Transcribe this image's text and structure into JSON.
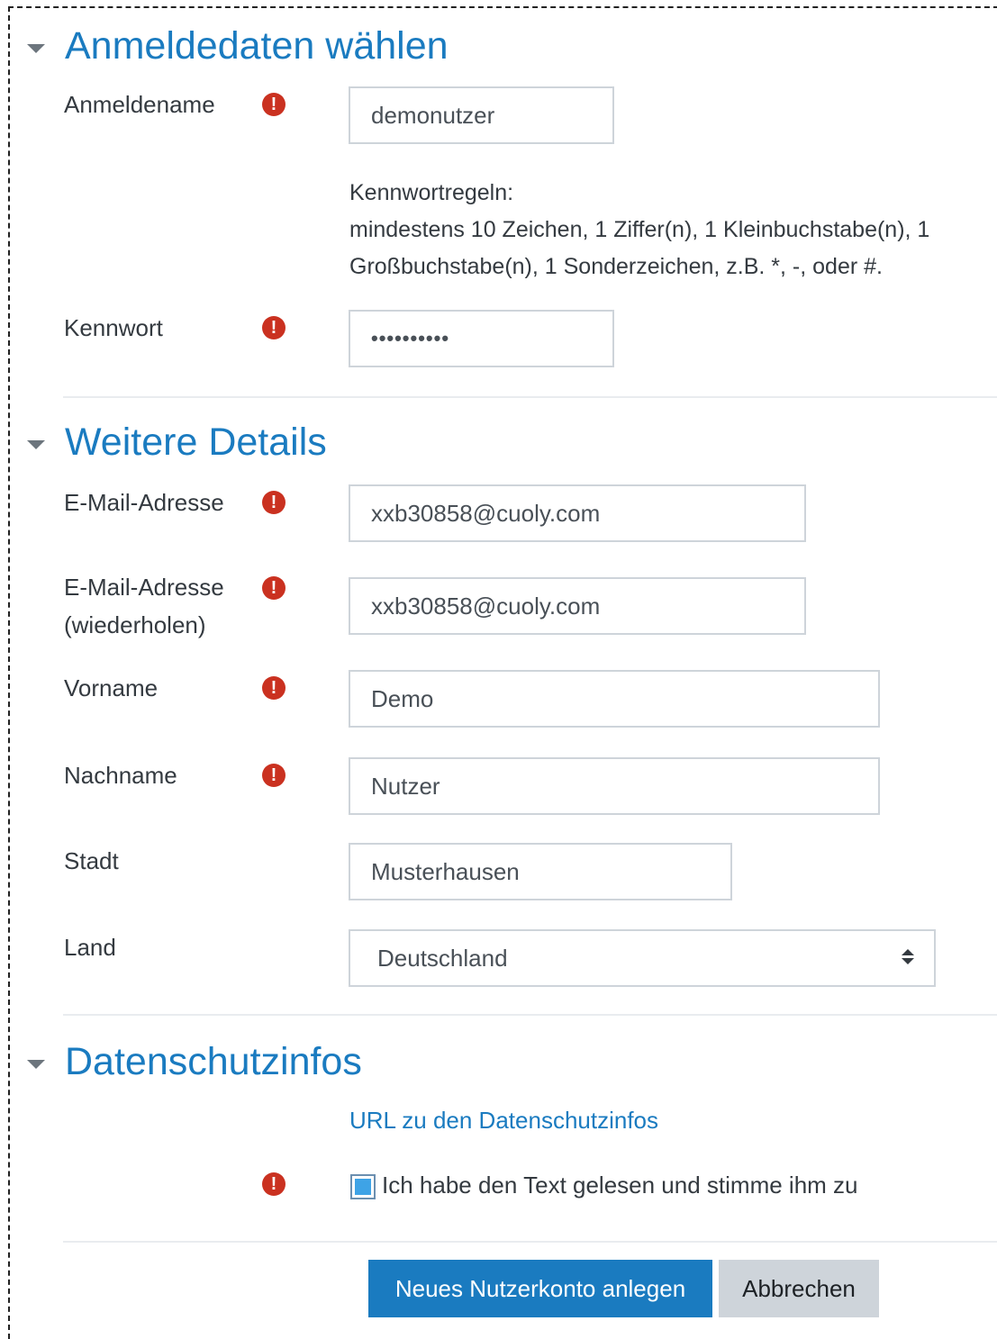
{
  "sections": {
    "login": {
      "title": "Anmeldedaten wählen"
    },
    "details": {
      "title": "Weitere Details"
    },
    "privacy": {
      "title": "Datenschutzinfos"
    }
  },
  "fields": {
    "username": {
      "label": "Anmeldename",
      "value": "demonutzer"
    },
    "password_rules": {
      "heading": "Kennwortregeln:",
      "text": "mindestens 10 Zeichen, 1 Ziffer(n), 1 Kleinbuchstabe(n), 1 Großbuchstabe(n), 1 Sonderzeichen, z.B. *, -, oder #."
    },
    "password": {
      "label": "Kennwort",
      "value": "••••••••••"
    },
    "email": {
      "label": "E-Mail-Adresse",
      "value": "xxb30858@cuoly.com"
    },
    "email_repeat": {
      "label_line1": "E-Mail-Adresse",
      "label_line2": "(wiederholen)",
      "value": "xxb30858@cuoly.com"
    },
    "firstname": {
      "label": "Vorname",
      "value": "Demo"
    },
    "lastname": {
      "label": "Nachname",
      "value": "Nutzer"
    },
    "city": {
      "label": "Stadt",
      "value": "Musterhausen"
    },
    "country": {
      "label": "Land",
      "value": "Deutschland"
    }
  },
  "privacy": {
    "link_text": "URL zu den Datenschutzinfos",
    "agree_label": "Ich habe den Text gelesen und stimme ihm zu",
    "agree_checked": true
  },
  "required_icon": "!",
  "buttons": {
    "submit": "Neues Nutzerkonto anlegen",
    "cancel": "Abbrechen"
  },
  "colors": {
    "accent": "#1a7bc0",
    "required": "#ca3120",
    "checkbox": "#3ea3e6"
  }
}
